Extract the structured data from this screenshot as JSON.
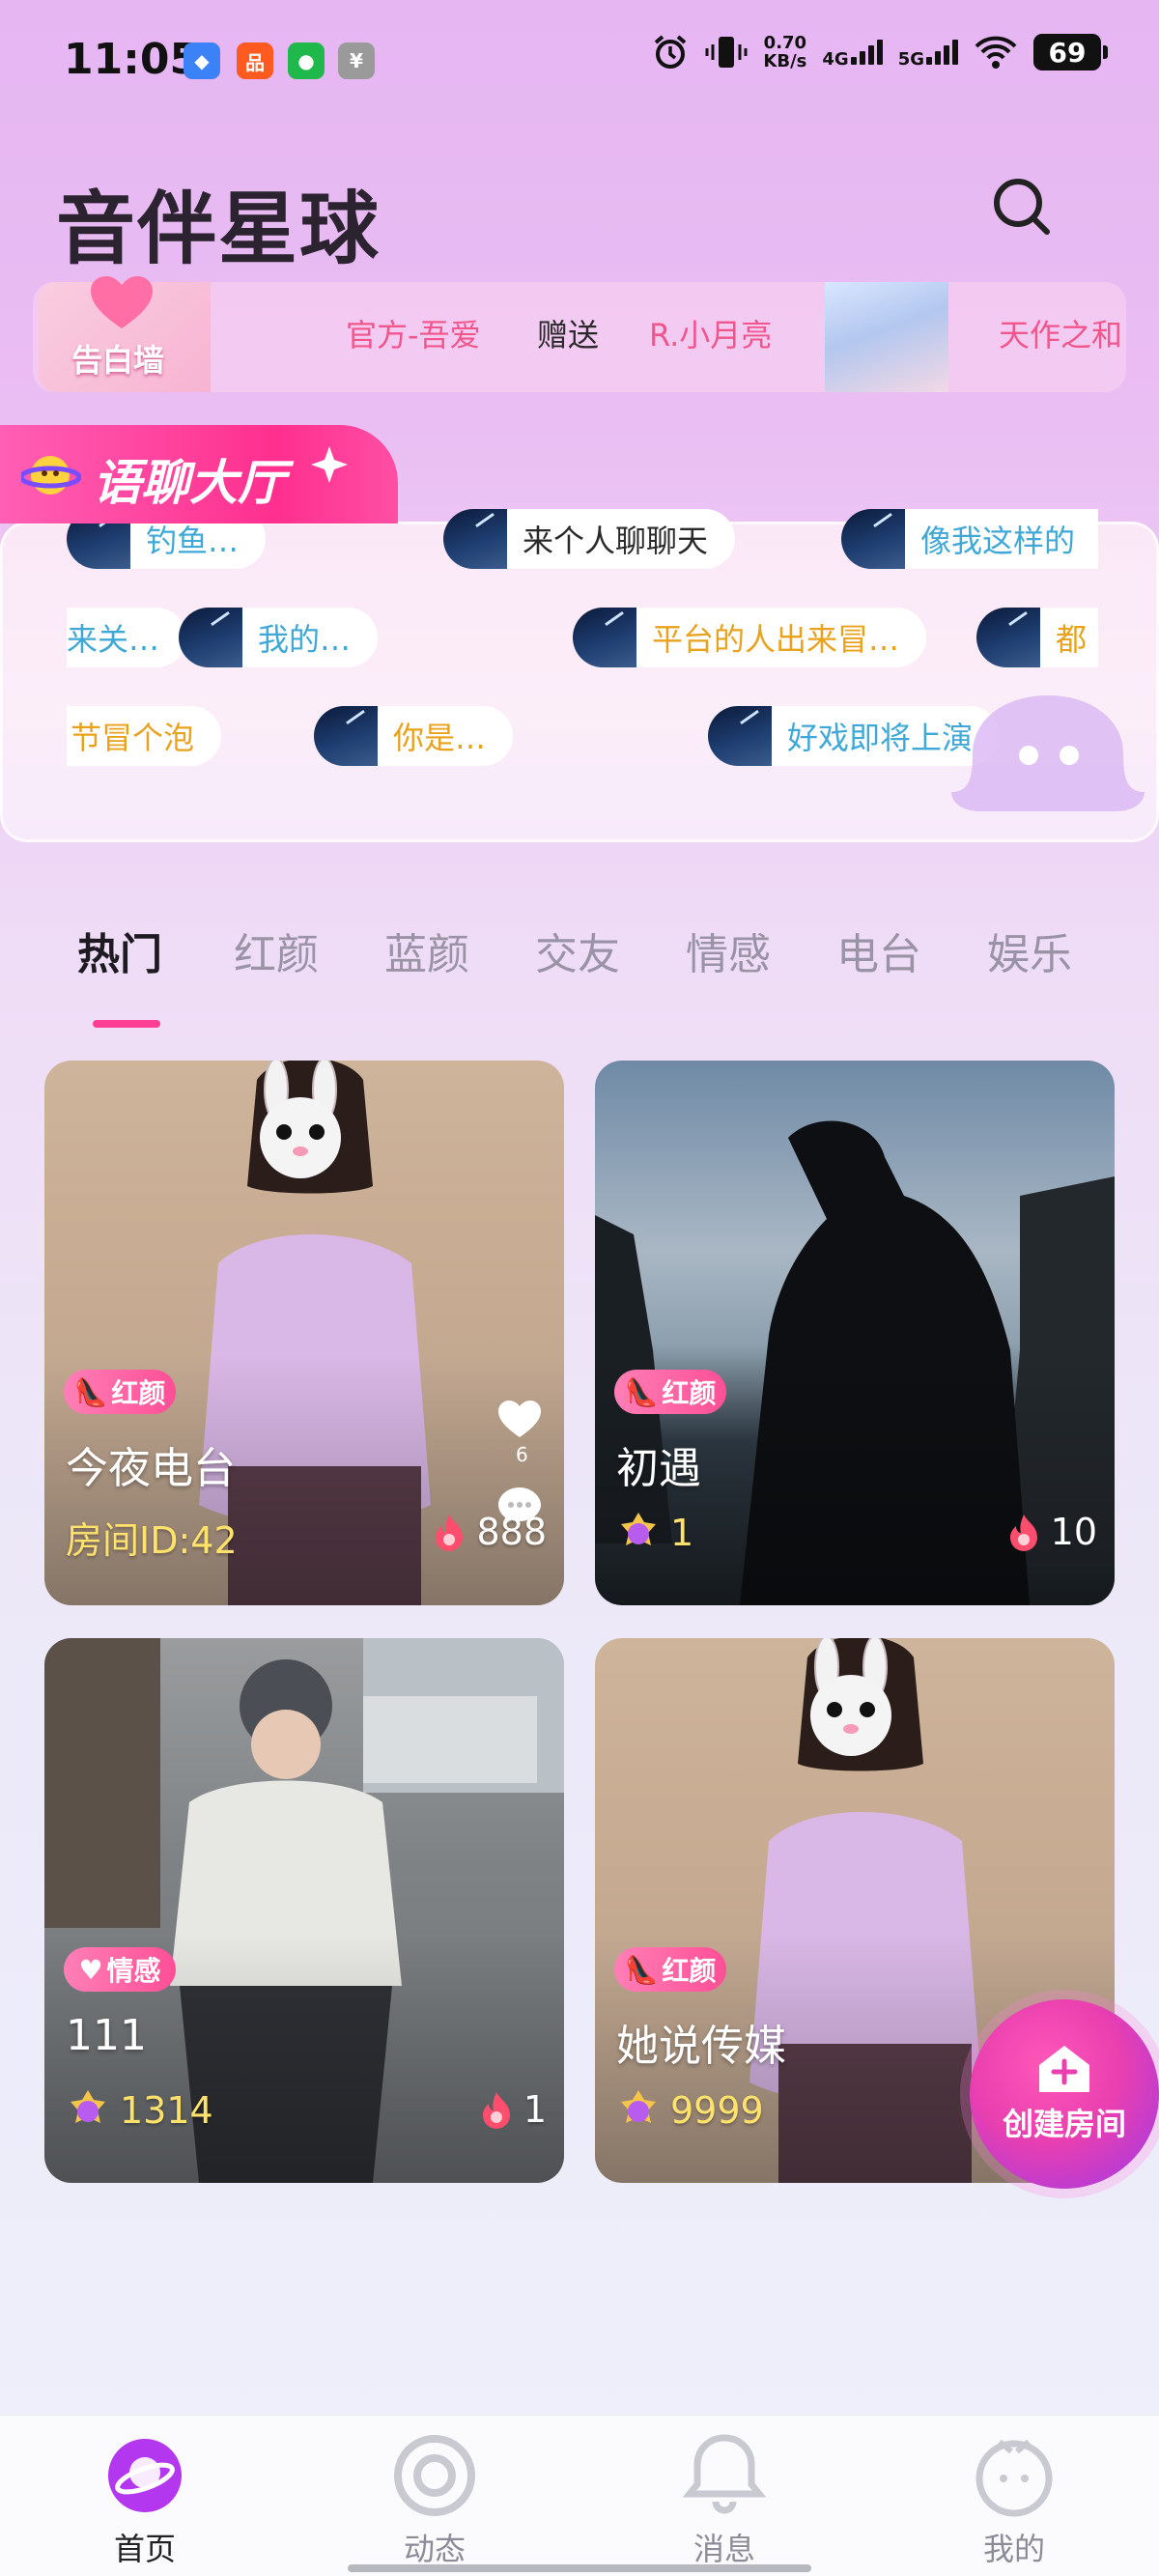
{
  "status_bar": {
    "time": "11:05",
    "net_speed_value": "0.70",
    "net_speed_unit": "KB/s",
    "signal_1": "4G",
    "signal_2": "5G",
    "battery": "69"
  },
  "header": {
    "title": "音伴星球",
    "search_icon": "search-icon"
  },
  "ticker": {
    "wall_label": "告白墙",
    "items": [
      "官方-吾爱",
      "赠送",
      "R.小月亮",
      "天作之和"
    ]
  },
  "chat_hall": {
    "title": "语聊大厅",
    "row1": [
      "钓鱼…",
      "来个人聊聊天",
      "像我这样的"
    ],
    "row2": [
      "来关…",
      "我的…",
      "平台的人出来冒…",
      "都"
    ],
    "row3": [
      "节冒个泡",
      "你是…",
      "好戏即将上演"
    ]
  },
  "tabs": [
    "热门",
    "红颜",
    "蓝颜",
    "交友",
    "情感",
    "电台",
    "娱乐"
  ],
  "rooms": [
    {
      "badge": "红颜",
      "name": "今夜电台",
      "sub": "房间ID:42",
      "heat": "888",
      "like_count": "6"
    },
    {
      "badge": "红颜",
      "name": "初遇",
      "level": "1",
      "heat": "10"
    },
    {
      "badge": "情感",
      "name": "111",
      "level": "1314",
      "heat": "1"
    },
    {
      "badge": "红颜",
      "name": "她说传媒",
      "level": "9999"
    }
  ],
  "fab": {
    "label": "创建房间"
  },
  "bottom_nav": [
    {
      "label": "首页",
      "icon": "planet-icon"
    },
    {
      "label": "动态",
      "icon": "ring-icon"
    },
    {
      "label": "消息",
      "icon": "bell-icon"
    },
    {
      "label": "我的",
      "icon": "face-icon"
    }
  ],
  "colors": {
    "accent_pink": "#ff3f93",
    "yellow_text": "#ffe26b",
    "ticker_pink": "#f0568c"
  }
}
